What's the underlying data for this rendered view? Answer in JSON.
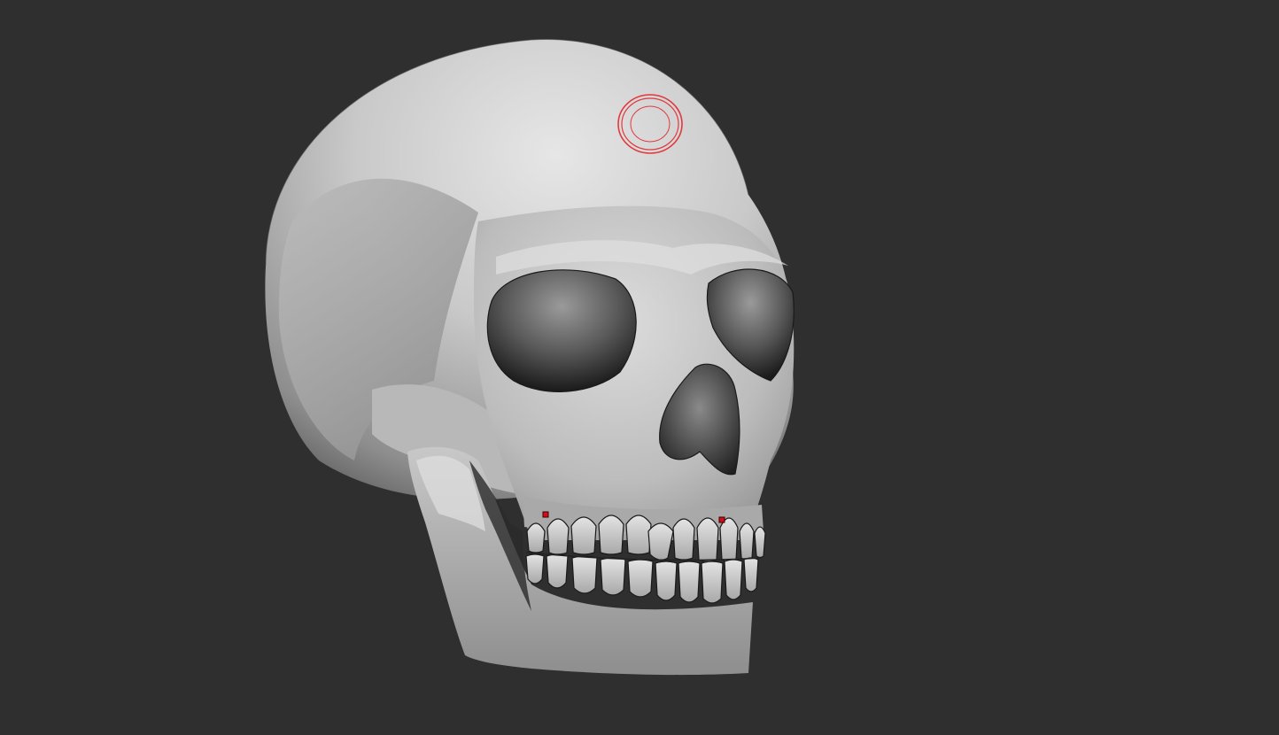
{
  "viewport": {
    "background_color": "#2f2f2f",
    "model": {
      "subject": "skull",
      "base_color": "#cfcfcf",
      "shadow_color": "#6a6a6a",
      "cavity_color": "#101010"
    },
    "brush_cursor": {
      "icon": "brush-ring-icon",
      "color": "#e0393e"
    },
    "markers": {
      "icon": "point-marker-icon",
      "color": "#d10f1b",
      "count": 2
    }
  }
}
